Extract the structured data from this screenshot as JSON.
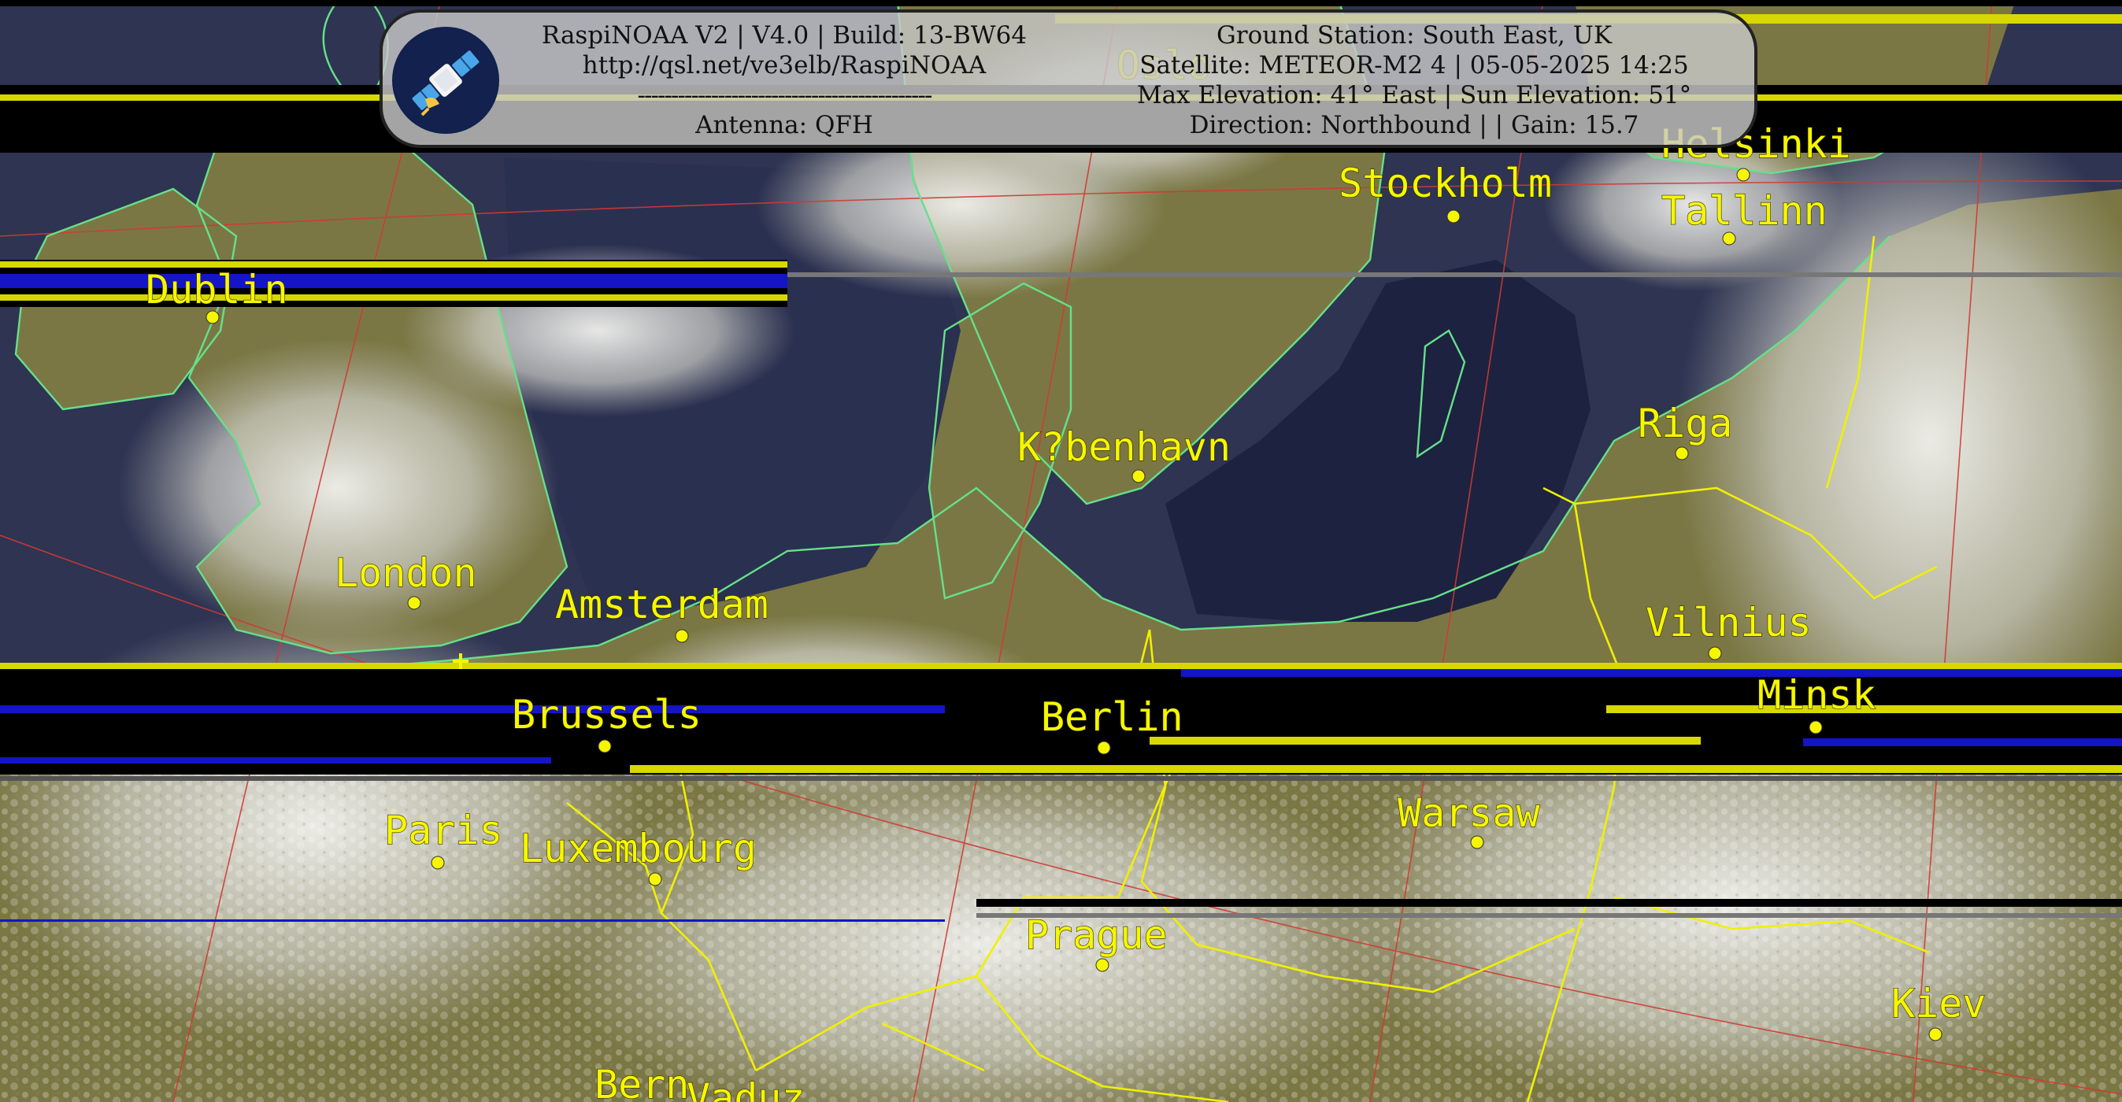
{
  "header": {
    "software_line": "RaspiNOAA V2 | V4.0 | Build: 13-BW64",
    "url": "http://qsl.net/ve3elb/RaspiNOAA",
    "separator": "--------------------------------------------",
    "antenna": "Antenna: QFH",
    "ground_station": "Ground Station: South East, UK",
    "satellite": "Satellite: METEOR-M2 4 | 05-05-2025 14:25",
    "elevation": "Max Elevation: 41° East | Sun Elevation: 51°",
    "direction": "Direction: Northbound | | Gain: 15.7",
    "logo_icon": "satellite-icon"
  },
  "cities": [
    {
      "name": "Helsinki"
    },
    {
      "name": "Stockholm"
    },
    {
      "name": "Tallinn"
    },
    {
      "name": "Dublin"
    },
    {
      "name": "Riga"
    },
    {
      "name": "K?benhavn"
    },
    {
      "name": "London"
    },
    {
      "name": "Amsterdam"
    },
    {
      "name": "Vilnius"
    },
    {
      "name": "Minsk"
    },
    {
      "name": "Brussels"
    },
    {
      "name": "Berlin"
    },
    {
      "name": "Paris"
    },
    {
      "name": "Luxembourg"
    },
    {
      "name": "Warsaw"
    },
    {
      "name": "Prague"
    },
    {
      "name": "Kiev"
    },
    {
      "name": "Bern"
    },
    {
      "name": "Vaduz"
    },
    {
      "name": "Oslo"
    }
  ],
  "colors": {
    "label": "#f6f600",
    "border": "#f0f000",
    "coastline": "#66e08a",
    "graticule": "#d03a32",
    "sea": "#2d3350",
    "land": "#7e7a45",
    "cloud": "#d2d2cc"
  }
}
